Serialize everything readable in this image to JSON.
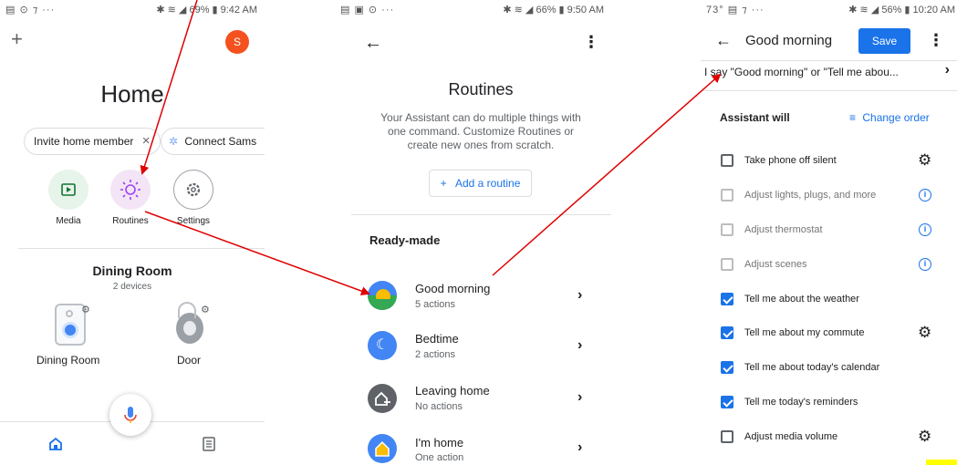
{
  "panel1": {
    "status_left": "▤ ⊙ ⁊ ···",
    "status_right": "✱ ≋ ◢ 69% ▮ 9:42 AM",
    "add_icon": "+",
    "avatar_letter": "S",
    "title": "Home",
    "chip_invite": "Invite home member",
    "chip_invite_close": "×",
    "chip_connect": "Connect Sams",
    "shortcuts": [
      {
        "label": "Media"
      },
      {
        "label": "Routines"
      },
      {
        "label": "Settings"
      }
    ],
    "room_title": "Dining Room",
    "room_sub": "2 devices",
    "devices": [
      {
        "label": "Dining Room"
      },
      {
        "label": "Door"
      }
    ]
  },
  "panel2": {
    "status_left": "▤ ▣ ⊙ ···",
    "status_right": "✱ ≋ ◢ 66% ▮ 9:50 AM",
    "title": "Routines",
    "description": "Your Assistant can do multiple things with one command. Customize Routines or create new ones from scratch.",
    "add_button": "Add a routine",
    "section": "Ready-made",
    "routines": [
      {
        "title": "Good morning",
        "sub": "5 actions"
      },
      {
        "title": "Bedtime",
        "sub": "2 actions"
      },
      {
        "title": "Leaving home",
        "sub": "No actions"
      },
      {
        "title": "I'm home",
        "sub": "One action"
      }
    ]
  },
  "panel3": {
    "status_left": "73° ▤ ⁊ ···",
    "status_right": "✱ ≋ ◢ 56% ▮ 10:20 AM",
    "title": "Good morning",
    "save_label": "Save",
    "trigger": "I say \"Good morning\" or \"Tell me abou...",
    "assistant_will": "Assistant will",
    "change_order": "Change order",
    "actions": [
      {
        "label": "Take phone off silent",
        "state": "off",
        "icon": "gear"
      },
      {
        "label": "Adjust lights, plugs, and more",
        "state": "disabled",
        "icon": "info"
      },
      {
        "label": "Adjust thermostat",
        "state": "disabled",
        "icon": "info"
      },
      {
        "label": "Adjust scenes",
        "state": "disabled",
        "icon": "info"
      },
      {
        "label": "Tell me about the weather",
        "state": "on",
        "icon": ""
      },
      {
        "label": "Tell me about my commute",
        "state": "on",
        "icon": "gear"
      },
      {
        "label": "Tell me about today's calendar",
        "state": "on",
        "icon": ""
      },
      {
        "label": "Tell me today's reminders",
        "state": "on",
        "icon": ""
      },
      {
        "label": "Adjust media volume",
        "state": "off",
        "icon": "gear"
      }
    ]
  },
  "colors": {
    "accent": "#1a73e8",
    "annotation": "#e00000",
    "avatar": "#f4511e",
    "media_bg": "#e6f4ea",
    "routines_bg": "#f3e5f5"
  }
}
